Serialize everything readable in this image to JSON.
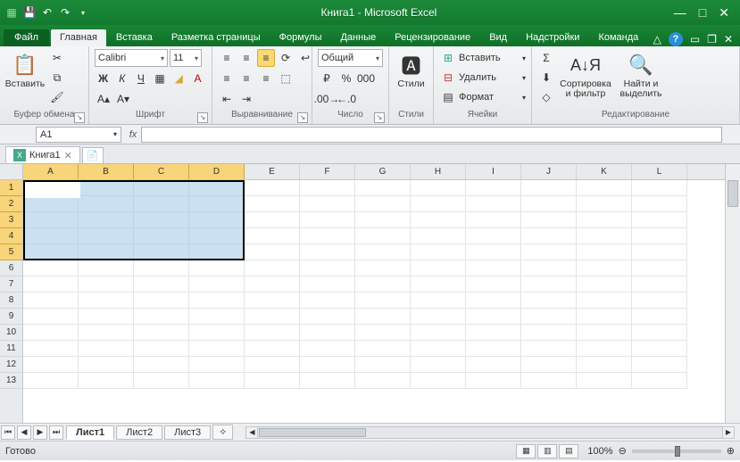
{
  "title": "Книга1 - Microsoft Excel",
  "qat": {
    "save": "💾",
    "undo": "↶",
    "redo": "↷"
  },
  "tabs": {
    "file": "Файл",
    "items": [
      "Главная",
      "Вставка",
      "Разметка страницы",
      "Формулы",
      "Данные",
      "Рецензирование",
      "Вид",
      "Надстройки",
      "Команда"
    ],
    "active": 0
  },
  "ribbon": {
    "clipboard": {
      "label": "Буфер обмена",
      "paste": "Вставить"
    },
    "font": {
      "label": "Шрифт",
      "name": "Calibri",
      "size": "11",
      "bold": "Ж",
      "italic": "К",
      "underline": "Ч"
    },
    "align": {
      "label": "Выравнивание"
    },
    "number": {
      "label": "Число",
      "format": "Общий"
    },
    "styles": {
      "label": "Стили",
      "btn": "Стили"
    },
    "cells": {
      "label": "Ячейки",
      "insert": "Вставить",
      "delete": "Удалить",
      "format": "Формат"
    },
    "editing": {
      "label": "Редактирование",
      "sort": "Сортировка\nи фильтр",
      "find": "Найти и\nвыделить"
    }
  },
  "namebox": "A1",
  "workbook_tab": "Книга1",
  "columns": [
    "A",
    "B",
    "C",
    "D",
    "E",
    "F",
    "G",
    "H",
    "I",
    "J",
    "K",
    "L"
  ],
  "rows": [
    "1",
    "2",
    "3",
    "4",
    "5",
    "6",
    "7",
    "8",
    "9",
    "10",
    "11",
    "12",
    "13"
  ],
  "selection": {
    "cols_sel": 4,
    "rows_sel": 5
  },
  "sheets": {
    "items": [
      "Лист1",
      "Лист2",
      "Лист3"
    ],
    "active": 0
  },
  "status": {
    "ready": "Готово",
    "zoom": "100%"
  }
}
